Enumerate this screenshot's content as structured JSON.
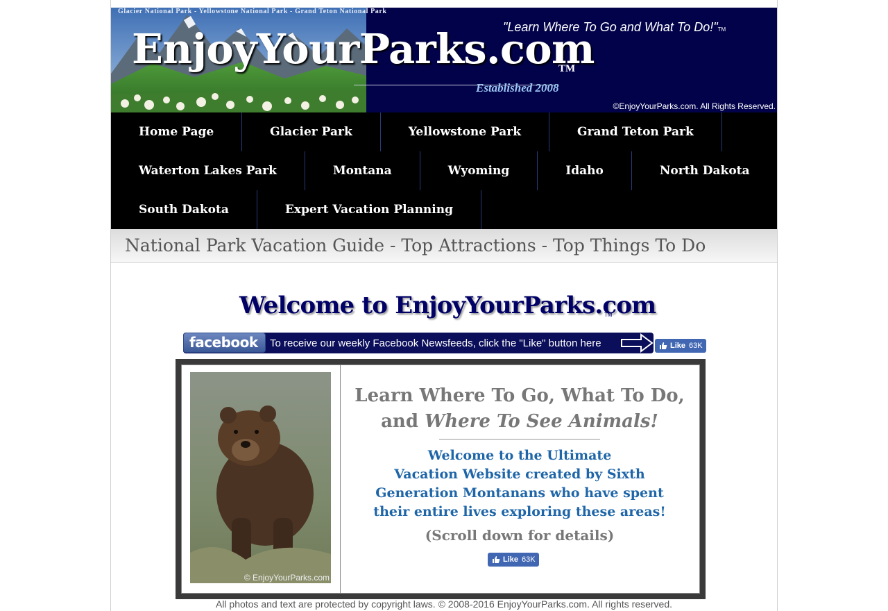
{
  "banner": {
    "parks_strip": "Glacier National Park - Yellowstone National Park - Grand Teton National Park",
    "logo": "EnjoyYourParks.com",
    "logo_tm": "TM",
    "slogan": "\"Learn Where To Go and What To Do!\"",
    "slogan_tm": "TM",
    "established": "Established 2008",
    "copyright": "©EnjoyYourParks.com.  All Rights Reserved."
  },
  "nav": {
    "row1": [
      "Home Page",
      "Glacier Park",
      "Yellowstone Park",
      "Grand Teton Park"
    ],
    "row2": [
      "Waterton Lakes Park",
      "Montana",
      "Wyoming",
      "Idaho",
      "North Dakota"
    ],
    "row3": [
      "South Dakota",
      "Expert Vacation Planning"
    ]
  },
  "guide_bar": {
    "text": "National Park Vacation Guide - Top Attractions - Top Things To Do"
  },
  "welcome": {
    "title": "Welcome to EnjoyYourParks.com",
    "tm": "TM"
  },
  "facebook": {
    "logo": "facebook",
    "message": "To receive our weekly Facebook Newsfeeds, click the \"Like\" button here",
    "like_label": "Like",
    "like_count": "63K"
  },
  "feature": {
    "headline_line1": "Learn Where To Go, What To Do,",
    "headline_line2_plain": "and ",
    "headline_line2_italic": "Where To See Animals!",
    "blurb_lines": [
      "Welcome to the Ultimate",
      "Vacation Website created by Sixth",
      "Generation Montanans who have spent",
      "their entire lives exploring these areas!"
    ],
    "scroll_note": "(Scroll down for details)",
    "like_label": "Like",
    "like_count": "63K",
    "photo_credit": "© EnjoyYourParks.com"
  },
  "footer": {
    "text": "All photos and text are protected by copyright laws.  © 2008-2016 EnjoyYourParks.com.  All rights reserved."
  }
}
